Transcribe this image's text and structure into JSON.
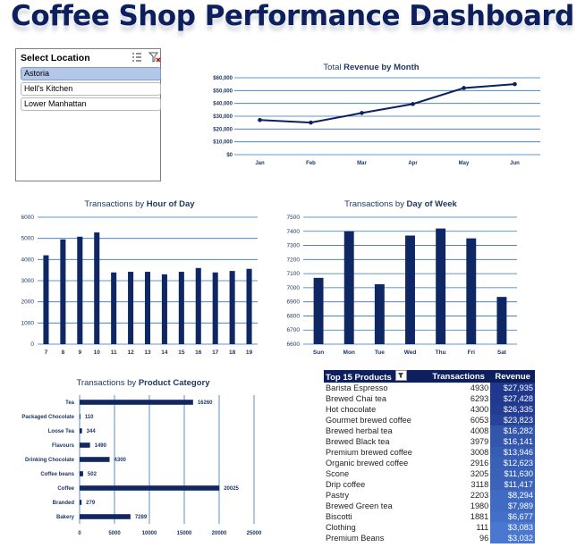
{
  "title": "Coffee Shop Performance Dashboard",
  "slicer": {
    "title": "Select Location",
    "items": [
      {
        "label": "Astoria",
        "selected": true
      },
      {
        "label": "Hell's Kitchen",
        "selected": false
      },
      {
        "label": "Lower Manhattan",
        "selected": false
      }
    ]
  },
  "colors": {
    "dark_navy": "#0d1f5c",
    "bar": "#0f2864",
    "grid": "#2e75b6",
    "slicer_selected": "#b4c7e7"
  },
  "chart_data": [
    {
      "id": "revenue_by_month",
      "type": "line",
      "title_prefix": "Total ",
      "title_bold": "Revenue by Month",
      "categories": [
        "Jan",
        "Feb",
        "Mar",
        "Apr",
        "May",
        "Jun"
      ],
      "values": [
        27000,
        25000,
        32500,
        39500,
        52000,
        55000
      ],
      "y_ticks": [
        "$0",
        "$10,000",
        "$20,000",
        "$30,000",
        "$40,000",
        "$50,000",
        "$60,000"
      ],
      "ylim": [
        0,
        60000
      ],
      "grid": true
    },
    {
      "id": "transactions_by_hour",
      "type": "bar",
      "title_prefix": "Transactions by ",
      "title_bold": "Hour of Day",
      "categories": [
        "7",
        "8",
        "9",
        "10",
        "11",
        "12",
        "13",
        "14",
        "15",
        "16",
        "17",
        "18",
        "19"
      ],
      "values": [
        4200,
        4950,
        5080,
        5280,
        3390,
        3420,
        3420,
        3300,
        3420,
        3600,
        3390,
        3460,
        3560
      ],
      "y_ticks": [
        "0",
        "1000",
        "2000",
        "3000",
        "4000",
        "5000",
        "6000"
      ],
      "ylim": [
        0,
        6000
      ],
      "grid": true
    },
    {
      "id": "transactions_by_weekday",
      "type": "bar",
      "title_prefix": "Transactions by ",
      "title_bold": "Day of Week",
      "categories": [
        "Sun",
        "Mon",
        "Tue",
        "Wed",
        "Thu",
        "Fri",
        "Sat"
      ],
      "values": [
        7070,
        7400,
        7025,
        7370,
        7420,
        7350,
        6935
      ],
      "y_ticks": [
        "6600",
        "6700",
        "6800",
        "6900",
        "7000",
        "7100",
        "7200",
        "7300",
        "7400",
        "7500"
      ],
      "ylim": [
        6600,
        7500
      ],
      "grid": true
    },
    {
      "id": "transactions_by_category",
      "type": "bar",
      "orientation": "horizontal",
      "title_prefix": "Transactions by ",
      "title_bold": "Product Category",
      "categories": [
        "Tea",
        "Packaged Chocolate",
        "Loose Tea",
        "Flavours",
        "Drinking Chocolate",
        "Coffee beans",
        "Coffee",
        "Branded",
        "Bakery"
      ],
      "values": [
        16260,
        110,
        344,
        1490,
        4300,
        502,
        20025,
        279,
        7289
      ],
      "value_labels": [
        "16260",
        "110",
        "344",
        "1490",
        "4300",
        "502",
        "20025",
        "279",
        "7289"
      ],
      "x_ticks": [
        "0",
        "5000",
        "10000",
        "15000",
        "20000",
        "25000"
      ],
      "xlim": [
        0,
        25000
      ],
      "grid": true
    },
    {
      "id": "top_products",
      "type": "table",
      "headers": [
        "Top 15 Products",
        "Transactions",
        "Revenue"
      ],
      "rows": [
        {
          "product": "Barista Espresso",
          "transactions": "4930",
          "revenue": "$27,935",
          "value": 27935
        },
        {
          "product": "Brewed Chai tea",
          "transactions": "6293",
          "revenue": "$27,428",
          "value": 27428
        },
        {
          "product": "Hot chocolate",
          "transactions": "4300",
          "revenue": "$26,335",
          "value": 26335
        },
        {
          "product": "Gourmet brewed coffee",
          "transactions": "6053",
          "revenue": "$23,823",
          "value": 23823
        },
        {
          "product": "Brewed herbal tea",
          "transactions": "4008",
          "revenue": "$16,282",
          "value": 16282
        },
        {
          "product": "Brewed Black tea",
          "transactions": "3979",
          "revenue": "$16,141",
          "value": 16141
        },
        {
          "product": "Premium brewed coffee",
          "transactions": "3008",
          "revenue": "$13,946",
          "value": 13946
        },
        {
          "product": "Organic brewed coffee",
          "transactions": "2916",
          "revenue": "$12,623",
          "value": 12623
        },
        {
          "product": "Scone",
          "transactions": "3205",
          "revenue": "$11,630",
          "value": 11630
        },
        {
          "product": "Drip coffee",
          "transactions": "3118",
          "revenue": "$11,417",
          "value": 11417
        },
        {
          "product": "Pastry",
          "transactions": "2203",
          "revenue": "$8,294",
          "value": 8294
        },
        {
          "product": "Brewed Green tea",
          "transactions": "1980",
          "revenue": "$7,989",
          "value": 7989
        },
        {
          "product": "Biscotti",
          "transactions": "1881",
          "revenue": "$6,677",
          "value": 6677
        },
        {
          "product": "Clothing",
          "transactions": "111",
          "revenue": "$3,083",
          "value": 3083
        },
        {
          "product": "Premium Beans",
          "transactions": "96",
          "revenue": "$3,032",
          "value": 3032
        }
      ]
    }
  ]
}
